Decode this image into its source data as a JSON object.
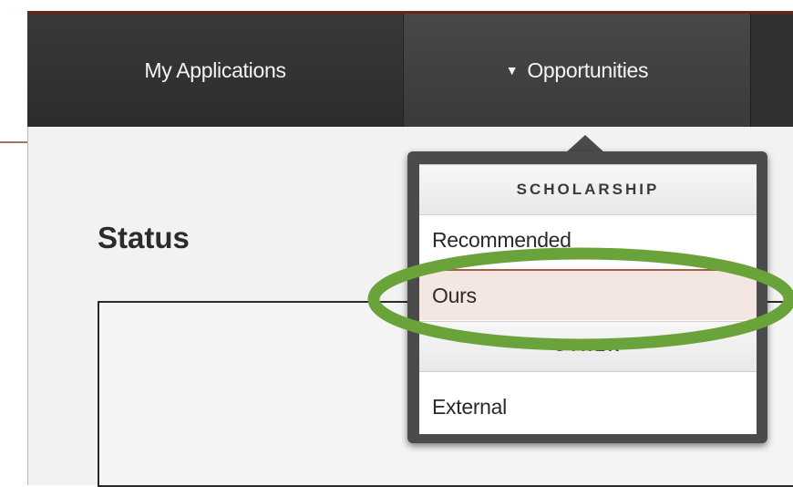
{
  "nav": {
    "my_applications": "My Applications",
    "opportunities": "Opportunities",
    "caret": "▼"
  },
  "page": {
    "title": "Status"
  },
  "dropdown": {
    "sections": [
      {
        "header": "SCHOLARSHIP",
        "items": [
          "Recommended",
          "Ours"
        ]
      },
      {
        "header": "OTHER",
        "items": [
          "External"
        ]
      }
    ],
    "active_item": "Ours"
  },
  "annotation": {
    "ring_color": "#6aa33a"
  },
  "colors": {
    "nav_bg": "#2e2c2b",
    "nav_accent": "#6b2418",
    "active_row": "#f4e7e2"
  }
}
